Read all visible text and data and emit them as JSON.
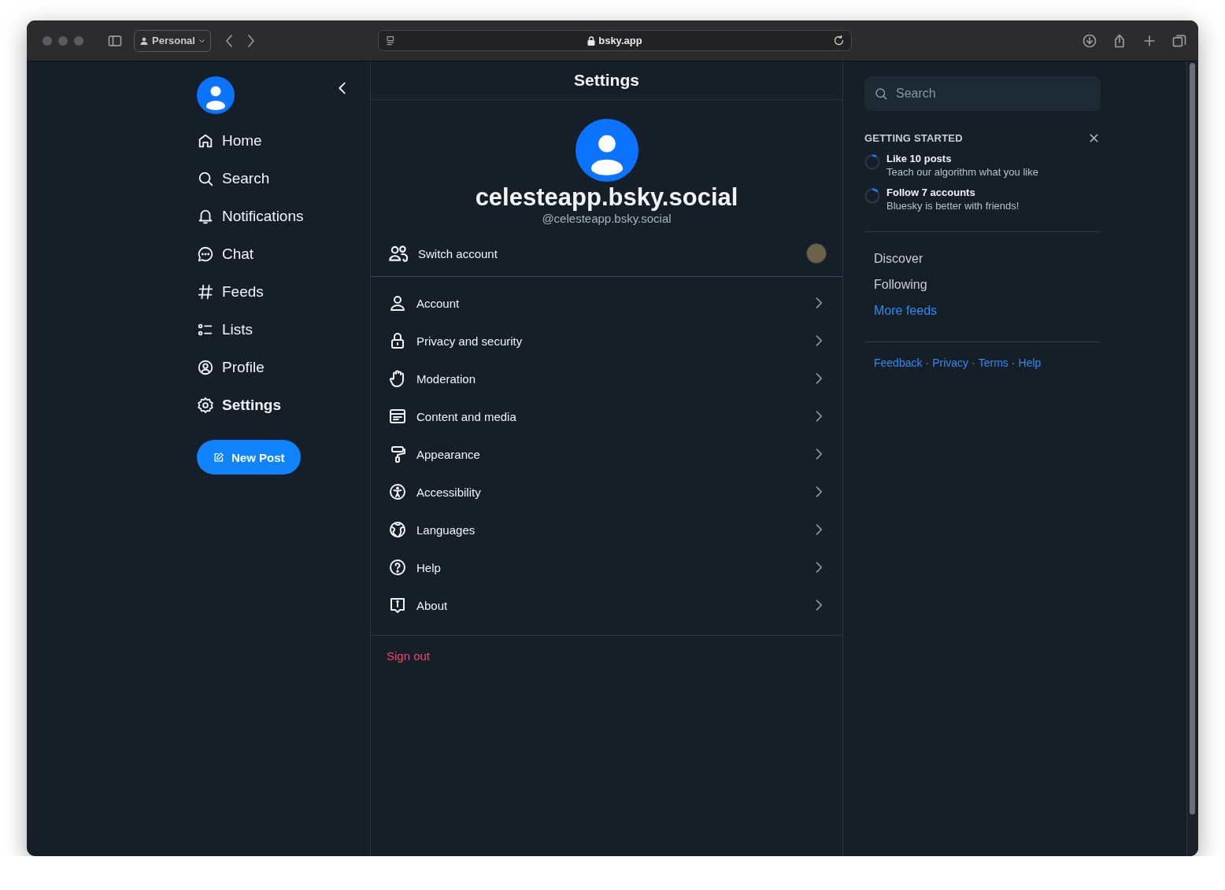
{
  "browser": {
    "profile": "Personal",
    "url": "bsky.app"
  },
  "nav": {
    "items": [
      {
        "label": "Home",
        "selected": false
      },
      {
        "label": "Search",
        "selected": false
      },
      {
        "label": "Notifications",
        "selected": false
      },
      {
        "label": "Chat",
        "selected": false
      },
      {
        "label": "Feeds",
        "selected": false
      },
      {
        "label": "Lists",
        "selected": false
      },
      {
        "label": "Profile",
        "selected": false
      },
      {
        "label": "Settings",
        "selected": true
      }
    ],
    "new_post_button": "New Post"
  },
  "settings": {
    "title": "Settings",
    "display_name": "celesteapp.bsky.social",
    "handle": "@celesteapp.bsky.social",
    "switch_account": "Switch account",
    "items": [
      "Account",
      "Privacy and security",
      "Moderation",
      "Content and media",
      "Appearance",
      "Accessibility",
      "Languages",
      "Help",
      "About"
    ],
    "sign_out": "Sign out"
  },
  "sidebar": {
    "search": {
      "placeholder": "Search"
    },
    "getting_started": {
      "title": "GETTING STARTED",
      "tasks": [
        {
          "title": "Like 10 posts",
          "subtitle": "Teach our algorithm what you like",
          "level": 0.1
        },
        {
          "title": "Follow 7 accounts",
          "subtitle": "Bluesky is better with friends!",
          "level": 0.14
        }
      ]
    },
    "feeds": [
      {
        "label": "Discover",
        "kind": "feed"
      },
      {
        "label": "Following",
        "kind": "feed"
      },
      {
        "label": "More feeds",
        "kind": "link"
      }
    ],
    "footer": [
      {
        "text": "Feedback",
        "kind": "link"
      },
      {
        "text": "·",
        "kind": "separator"
      },
      {
        "text": "Privacy",
        "kind": "link"
      },
      {
        "text": "·",
        "kind": "separator"
      },
      {
        "text": "Terms",
        "kind": "link"
      },
      {
        "text": "·",
        "kind": "separator"
      },
      {
        "text": "Help",
        "kind": "link"
      }
    ]
  }
}
